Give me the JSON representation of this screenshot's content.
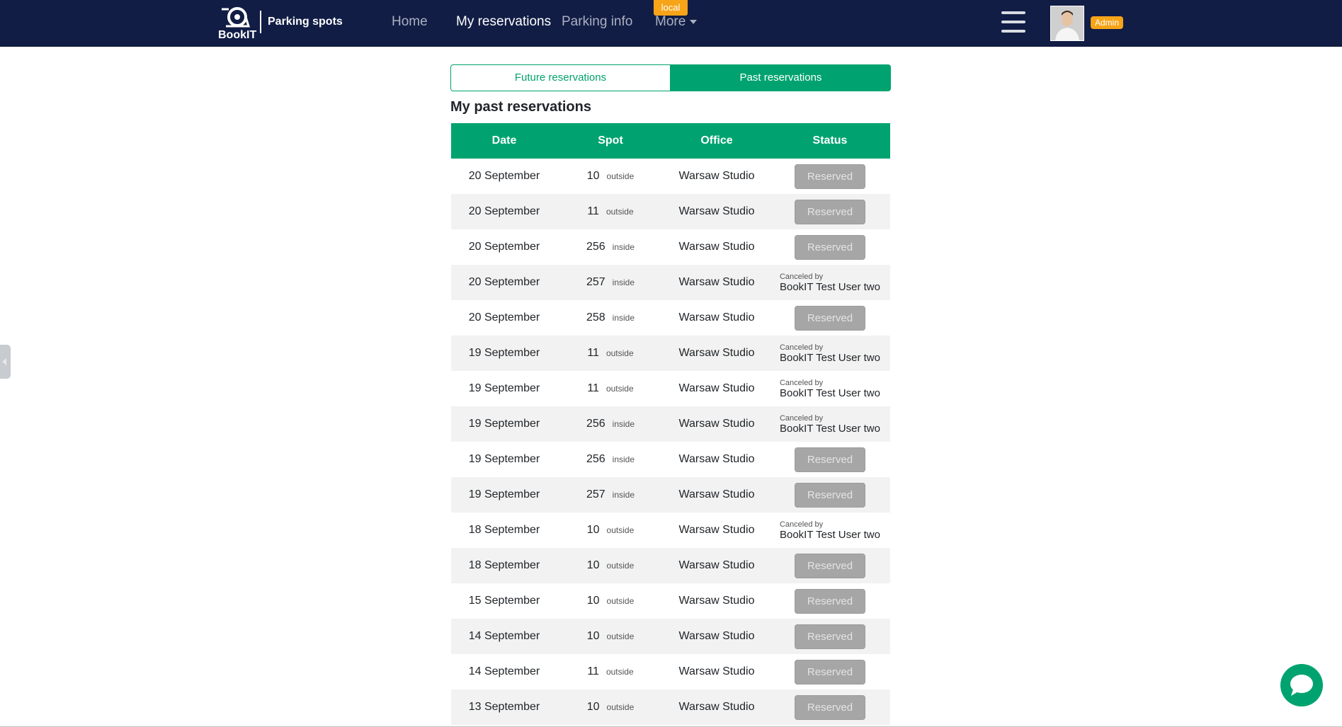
{
  "nav": {
    "logo_text": "BookIT",
    "brand_title": "Parking spots",
    "links": [
      {
        "label": "Home"
      },
      {
        "label": "My reservations"
      },
      {
        "label": "Parking info"
      },
      {
        "label": "More"
      }
    ],
    "env_badge": "local",
    "admin_badge": "Admin"
  },
  "tabs": {
    "future": "Future reservations",
    "past": "Past reservations"
  },
  "page_title": "My past reservations",
  "table": {
    "headers": [
      "Date",
      "Spot",
      "Office",
      "Status"
    ],
    "rows": [
      {
        "date": "20 September",
        "spot": "10",
        "loc": "outside",
        "office": "Warsaw Studio",
        "status": "Reserved"
      },
      {
        "date": "20 September",
        "spot": "11",
        "loc": "outside",
        "office": "Warsaw Studio",
        "status": "Reserved"
      },
      {
        "date": "20 September",
        "spot": "256",
        "loc": "inside",
        "office": "Warsaw Studio",
        "status": "Reserved"
      },
      {
        "date": "20 September",
        "spot": "257",
        "loc": "inside",
        "office": "Warsaw Studio",
        "canceled_label": "Canceled by",
        "canceled_by": "BookIT Test User two"
      },
      {
        "date": "20 September",
        "spot": "258",
        "loc": "inside",
        "office": "Warsaw Studio",
        "status": "Reserved"
      },
      {
        "date": "19 September",
        "spot": "11",
        "loc": "outside",
        "office": "Warsaw Studio",
        "canceled_label": "Canceled by",
        "canceled_by": "BookIT Test User two"
      },
      {
        "date": "19 September",
        "spot": "11",
        "loc": "outside",
        "office": "Warsaw Studio",
        "canceled_label": "Canceled by",
        "canceled_by": "BookIT Test User two"
      },
      {
        "date": "19 September",
        "spot": "256",
        "loc": "inside",
        "office": "Warsaw Studio",
        "canceled_label": "Canceled by",
        "canceled_by": "BookIT Test User two"
      },
      {
        "date": "19 September",
        "spot": "256",
        "loc": "inside",
        "office": "Warsaw Studio",
        "status": "Reserved"
      },
      {
        "date": "19 September",
        "spot": "257",
        "loc": "inside",
        "office": "Warsaw Studio",
        "status": "Reserved"
      },
      {
        "date": "18 September",
        "spot": "10",
        "loc": "outside",
        "office": "Warsaw Studio",
        "canceled_label": "Canceled by",
        "canceled_by": "BookIT Test User two"
      },
      {
        "date": "18 September",
        "spot": "10",
        "loc": "outside",
        "office": "Warsaw Studio",
        "status": "Reserved"
      },
      {
        "date": "15 September",
        "spot": "10",
        "loc": "outside",
        "office": "Warsaw Studio",
        "status": "Reserved"
      },
      {
        "date": "14 September",
        "spot": "10",
        "loc": "outside",
        "office": "Warsaw Studio",
        "status": "Reserved"
      },
      {
        "date": "14 September",
        "spot": "11",
        "loc": "outside",
        "office": "Warsaw Studio",
        "status": "Reserved"
      },
      {
        "date": "13 September",
        "spot": "10",
        "loc": "outside",
        "office": "Warsaw Studio",
        "status": "Reserved"
      }
    ]
  },
  "colors": {
    "navbar": "#111d45",
    "accent": "#00a36f",
    "badge": "#f7a418",
    "reserved_button": "#a6a6a6"
  },
  "icons": [
    "bookit-logo-icon",
    "hamburger-menu-icon",
    "chat-bubble-icon",
    "chevron-down-icon",
    "collapse-arrow-icon"
  ]
}
